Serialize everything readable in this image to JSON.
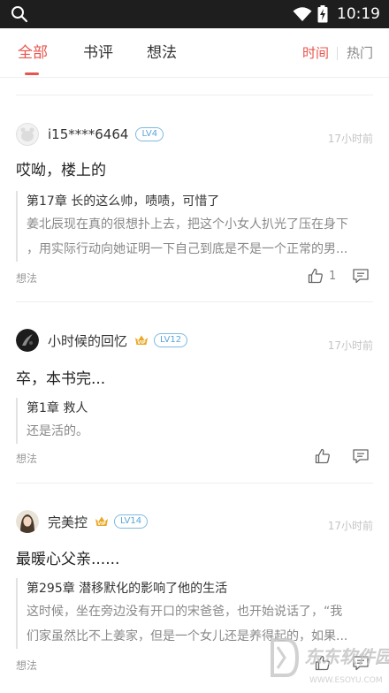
{
  "status_bar": {
    "time": "10:19",
    "icons": [
      "search-icon",
      "wifi-icon",
      "battery-charging-icon"
    ]
  },
  "tabs": [
    {
      "label": "全部",
      "active": true
    },
    {
      "label": "书评",
      "active": false
    },
    {
      "label": "想法",
      "active": false
    }
  ],
  "sort": [
    {
      "label": "时间",
      "active": true
    },
    {
      "label": "热门",
      "active": false
    }
  ],
  "feed": [
    {
      "username": "i15****6464",
      "vip": false,
      "level": "LV4",
      "time": "17小时前",
      "content": "哎呦，楼上的",
      "chapter": "第17章 长的这么帅，啧啧，可惜了",
      "excerpt_lines": [
        "姜北辰现在真的很想扑上去，把这个小女人扒光了压在身下",
        "，用实际行动向她证明一下自己到底是不是一个正常的男..."
      ],
      "tag": "想法",
      "likes": "1"
    },
    {
      "username": "小时候的回忆",
      "vip": true,
      "level": "LV12",
      "time": "17小时前",
      "content": "卒，本书完...",
      "chapter": "第1章 救人",
      "excerpt_lines": [
        "还是活的。"
      ],
      "tag": "想法",
      "likes": ""
    },
    {
      "username": "完美控",
      "vip": true,
      "level": "LV14",
      "time": "17小时前",
      "content": "最暖心父亲......",
      "chapter": "第295章 潜移默化的影响了他的生活",
      "excerpt_lines": [
        "这时候，坐在旁边没有开口的宋爸爸，也开始说话了，“我",
        "们家虽然比不上姜家，但是一个女儿还是养得起的，如果..."
      ],
      "tag": "想法",
      "likes": ""
    }
  ],
  "watermark": {
    "text": "东东软件园",
    "url_text": "WWW.ESOYU.COM"
  },
  "colors": {
    "accent": "#e8554e",
    "level_badge": "#5aa6d8",
    "vip_gold": "#e9a825",
    "status_bar": "#1e1e1e"
  }
}
